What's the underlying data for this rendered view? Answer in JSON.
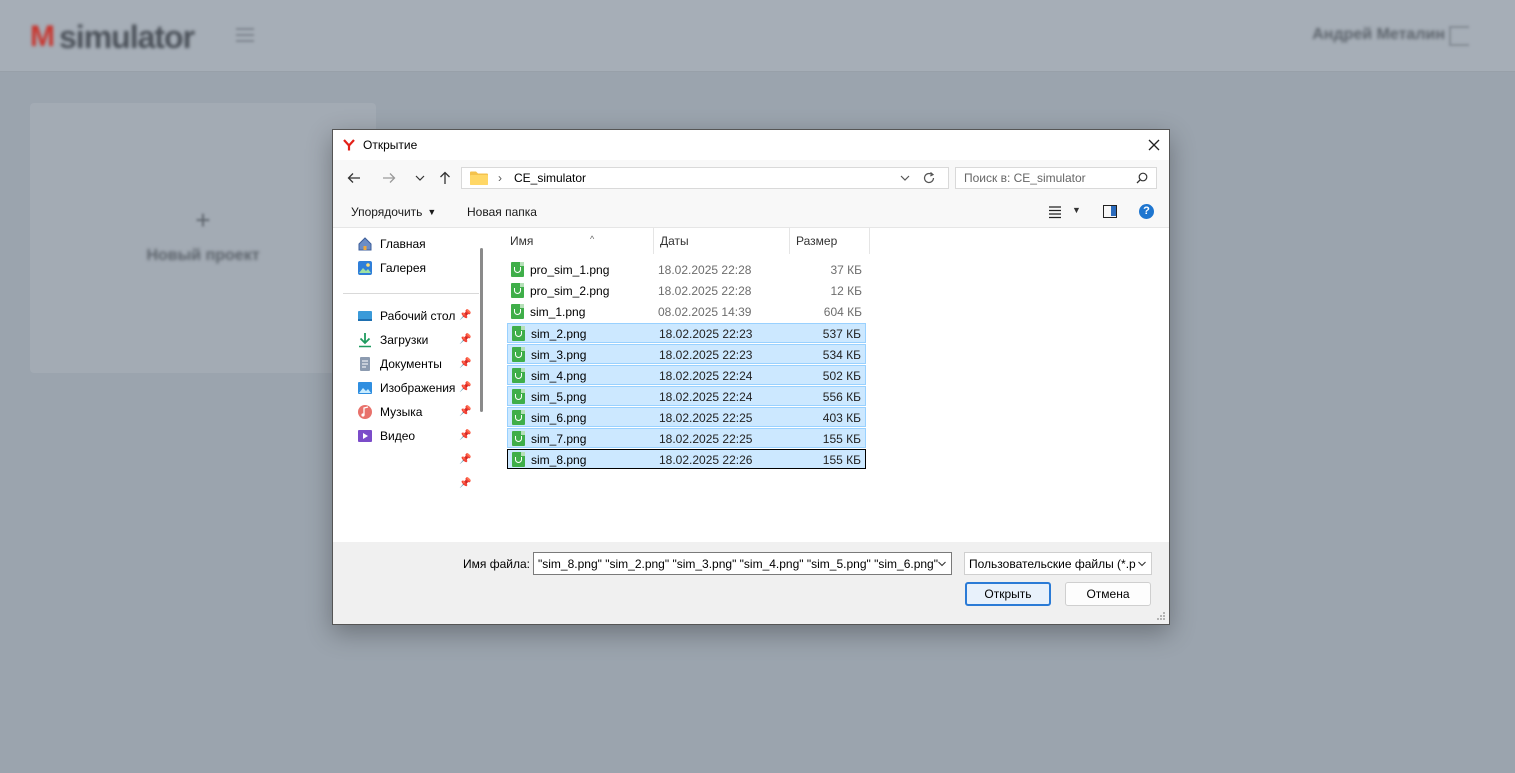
{
  "background_app": {
    "logo_mark": "M",
    "logo_text": "simulator",
    "user_name": "Андрей Металин",
    "new_project_plus": "+",
    "new_project_label": "Новый проект"
  },
  "dialog": {
    "title": "Открытие",
    "address": {
      "separator": "›",
      "folder": "CE_simulator"
    },
    "search": {
      "placeholder": "Поиск в: CE_simulator"
    },
    "toolbar": {
      "organize": "Упорядочить",
      "new_folder": "Новая папка",
      "help": "?"
    },
    "sidebar": {
      "items": [
        {
          "label": "Главная",
          "icon": "home-icon",
          "pinned": false
        },
        {
          "label": "Галерея",
          "icon": "gallery-icon",
          "pinned": false
        },
        {
          "label": "Рабочий стол",
          "icon": "desktop-icon",
          "pinned": true
        },
        {
          "label": "Загрузки",
          "icon": "downloads-icon",
          "pinned": true
        },
        {
          "label": "Документы",
          "icon": "documents-icon",
          "pinned": true
        },
        {
          "label": "Изображения",
          "icon": "pictures-icon",
          "pinned": true
        },
        {
          "label": "Музыка",
          "icon": "music-icon",
          "pinned": true
        },
        {
          "label": "Видео",
          "icon": "video-icon",
          "pinned": true
        }
      ]
    },
    "columns": {
      "name": "Имя",
      "date": "Даты",
      "size": "Размер"
    },
    "files": [
      {
        "name": "pro_sim_1.png",
        "date": "18.02.2025 22:28",
        "size": "37 КБ",
        "selected": false
      },
      {
        "name": "pro_sim_2.png",
        "date": "18.02.2025 22:28",
        "size": "12 КБ",
        "selected": false
      },
      {
        "name": "sim_1.png",
        "date": "08.02.2025 14:39",
        "size": "604 КБ",
        "selected": false
      },
      {
        "name": "sim_2.png",
        "date": "18.02.2025 22:23",
        "size": "537 КБ",
        "selected": true
      },
      {
        "name": "sim_3.png",
        "date": "18.02.2025 22:23",
        "size": "534 КБ",
        "selected": true
      },
      {
        "name": "sim_4.png",
        "date": "18.02.2025 22:24",
        "size": "502 КБ",
        "selected": true
      },
      {
        "name": "sim_5.png",
        "date": "18.02.2025 22:24",
        "size": "556 КБ",
        "selected": true
      },
      {
        "name": "sim_6.png",
        "date": "18.02.2025 22:25",
        "size": "403 КБ",
        "selected": true
      },
      {
        "name": "sim_7.png",
        "date": "18.02.2025 22:25",
        "size": "155 КБ",
        "selected": true
      },
      {
        "name": "sim_8.png",
        "date": "18.02.2025 22:26",
        "size": "155 КБ",
        "selected": true,
        "focused": true
      }
    ],
    "footer": {
      "filename_label": "Имя файла:",
      "filename_value": "\"sim_8.png\" \"sim_2.png\" \"sim_3.png\" \"sim_4.png\" \"sim_5.png\" \"sim_6.png\"",
      "filetype_value": "Пользовательские файлы (*.p",
      "open_button": "Открыть",
      "cancel_button": "Отмена"
    }
  },
  "colors": {
    "overlay": "#9aa3ad",
    "selection": "#cce8ff",
    "selection_border": "#99d1ff",
    "accent": "#2b7bd6",
    "file_icon": "#3fae49",
    "logo_red": "#c8362f"
  }
}
